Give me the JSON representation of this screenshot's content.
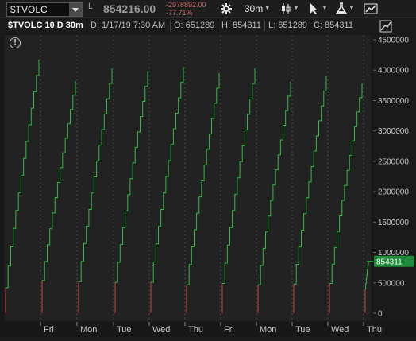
{
  "toolbar": {
    "symbol": "$TVOLC",
    "last_label": "L",
    "last_price": "854216.00",
    "change_abs": "-2978892.00",
    "change_pct": "-77.71%",
    "timeframe_label": "30m"
  },
  "info": {
    "title": "$TVOLC 10 D 30m",
    "date": "D: 1/17/19 7:30 AM",
    "open": "O: 651289",
    "high": "H: 854311",
    "low": "L: 651289",
    "close": "C: 854311"
  },
  "colors": {
    "up": "#33bb44",
    "down": "#cc4444",
    "price_tag": "#1f8a3a"
  },
  "chart_data": {
    "type": "line",
    "interval": "30m",
    "period": "10 D",
    "ylim": [
      -100000,
      4600000
    ],
    "y_ticks": [
      0,
      500000,
      1000000,
      1500000,
      2000000,
      2500000,
      3000000,
      3500000,
      4000000,
      4500000
    ],
    "y_tick_labels": [
      "0",
      "500000",
      "1000000",
      "1500000",
      "2000000",
      "2500000",
      "3000000",
      "3500000",
      "4000000",
      "4500000"
    ],
    "x_labels": [
      "Fri",
      "Mon",
      "Tue",
      "Wed",
      "Thu",
      "Fri",
      "Mon",
      "Tue",
      "Wed",
      "Thu"
    ],
    "sessions": [
      {
        "day": "Thu",
        "open": 420000,
        "close": 4180000
      },
      {
        "day": "Fri",
        "open": 540000,
        "close": 3820000
      },
      {
        "day": "Mon",
        "open": 520000,
        "close": 4030000
      },
      {
        "day": "Tue",
        "open": 510000,
        "close": 3980000
      },
      {
        "day": "Wed",
        "open": 510000,
        "close": 4050000
      },
      {
        "day": "Thu",
        "open": 470000,
        "close": 3950000
      },
      {
        "day": "Fri",
        "open": 490000,
        "close": 4030000
      },
      {
        "day": "Mon",
        "open": 470000,
        "close": 3810000
      },
      {
        "day": "Tue",
        "open": 480000,
        "close": 3900000
      },
      {
        "day": "Wed",
        "open": 490000,
        "close": 3780000
      },
      {
        "day": "Thu",
        "open": 400000,
        "close": 854311
      }
    ],
    "last_value": 854311,
    "last_value_label": "854311",
    "series": [
      {
        "values_source": "sessions"
      }
    ]
  }
}
